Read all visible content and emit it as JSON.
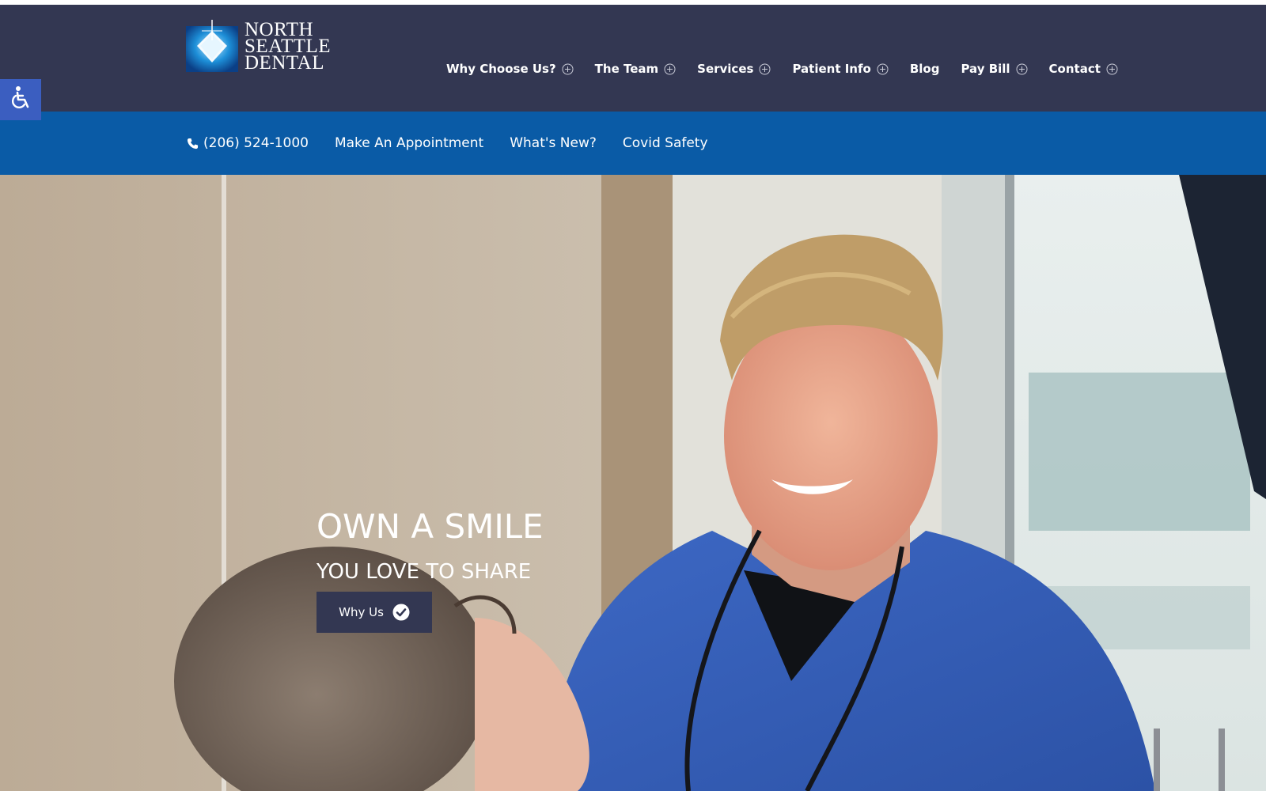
{
  "brand": {
    "logo_lines": [
      "NORTH",
      "SEATTLE",
      "DENTAL"
    ],
    "logo_icon": "diamond-logo-icon"
  },
  "main_nav": {
    "items": [
      {
        "label": "Why Choose Us?",
        "has_submenu": true
      },
      {
        "label": "The Team",
        "has_submenu": true
      },
      {
        "label": "Services",
        "has_submenu": true
      },
      {
        "label": "Patient Info",
        "has_submenu": true
      },
      {
        "label": "Blog",
        "has_submenu": false
      },
      {
        "label": "Pay Bill",
        "has_submenu": true
      },
      {
        "label": "Contact",
        "has_submenu": true
      }
    ]
  },
  "accessibility": {
    "icon": "wheelchair-icon"
  },
  "sub_nav": {
    "phone": "(206) 524-1000",
    "items": [
      "Make An Appointment",
      "What's New?",
      "Covid Safety"
    ]
  },
  "hero": {
    "title": "OWN A SMILE",
    "subtitle": "YOU LOVE TO SHARE",
    "button_label": "Why Us",
    "button_icon": "check-circle-icon"
  },
  "colors": {
    "header_bg": "#333752",
    "subbar_bg": "#0a5ba6",
    "accessibility_bg": "#3b5ec0",
    "button_bg": "#333752"
  }
}
